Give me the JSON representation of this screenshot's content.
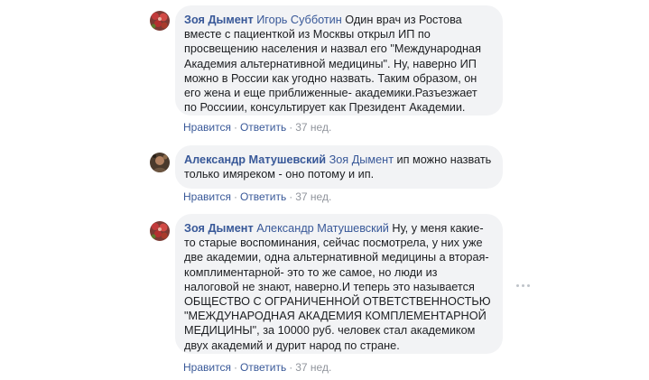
{
  "comments": [
    {
      "author": "Зоя Дымент",
      "mention": "Игорь Субботин",
      "text": " Один врач из Ростова вместе с пациенткой из Москвы открыл ИП по просвещению населения и назвал его \"Международная Академия альтернативной медицины\". Ну, наверно ИП можно в России как угодно назвать. Таким образом, он его жена и еще приближенные- академики.Разъезжает по Россиии, консультирует как Президент Академии.",
      "like": "Нравится",
      "reply": "Ответить",
      "sep": "·",
      "time": "37 нед."
    },
    {
      "author": "Александр Матушевский",
      "mention": "Зоя Дымент",
      "text": " ип можно назвать только имяреком - оно потому и ип.",
      "like": "Нравится",
      "reply": "Ответить",
      "sep": "·",
      "time": "37 нед."
    },
    {
      "author": "Зоя Дымент",
      "mention": "Александр Матушевский",
      "text": " Ну, у меня какие-то старые воспоминания, сейчас посмотрела, у них уже две академии, одна альтернативной медицины а вторая-комплиментарной- это то же самое, но люди из налоговой не знают, наверно.И теперь это называется ОБЩЕСТВО С ОГРАНИЧЕННОЙ ОТВЕТСТВЕННОСТЬЮ \"МЕЖДУНАРОДНАЯ АКАДЕМИЯ КОМПЛЕМЕНТАРНОЙ МЕДИЦИНЫ\", за 10000 руб. человек стал академиком двух академий и дурит народ по стране.",
      "like": "Нравится",
      "reply": "Ответить",
      "sep": "·",
      "time": "37 нед."
    }
  ],
  "icons": {
    "avatar_1": "avatar-flowers",
    "avatar_2": "avatar-photo",
    "avatar_3": "avatar-flowers",
    "more": "more-options-icon"
  },
  "colors": {
    "link": "#385898",
    "bubble": "#f2f3f5",
    "meta": "#90949c"
  }
}
